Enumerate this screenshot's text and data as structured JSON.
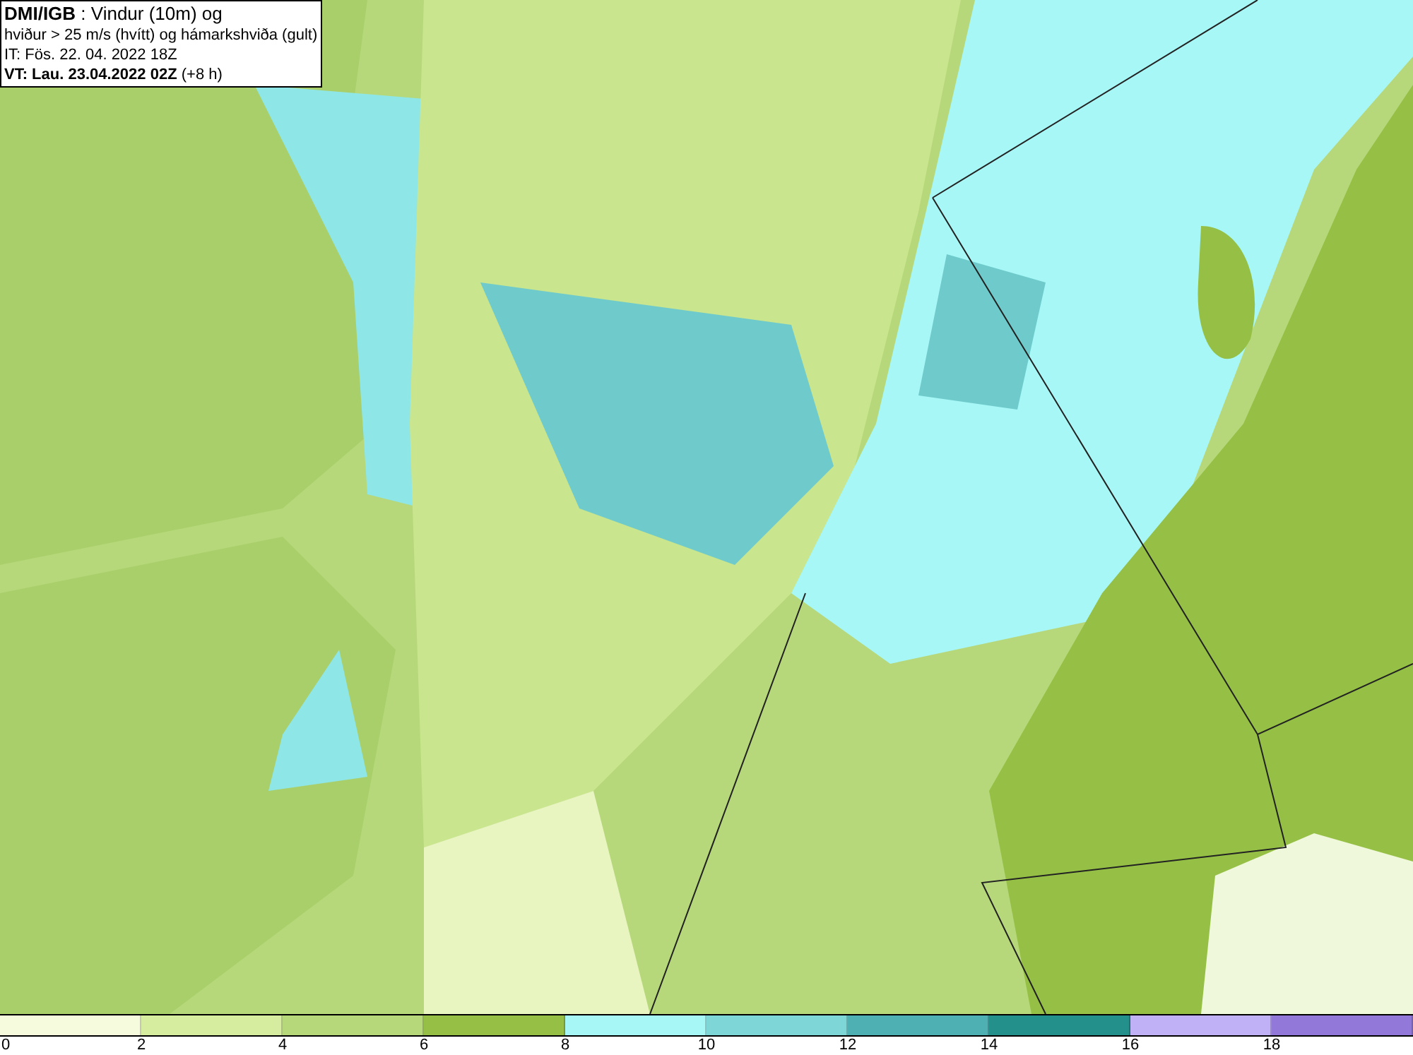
{
  "title_box": {
    "lines": [
      "**DMI/IGB** : Vindur (10m) og",
      "hviður > 25 m/s (hvítt) og hámarkshviða (gult)",
      "IT: Fös. 22. 04. 2022 18Z",
      "**VT: Lau. 23.04.2022 02Z** (+8 h)"
    ]
  },
  "legend": {
    "segments": [
      {
        "color": "#f5fbdc"
      },
      {
        "color": "#d6eda0"
      },
      {
        "color": "#b6d87a"
      },
      {
        "color": "#95c045"
      },
      {
        "color": "#a8f7f7"
      },
      {
        "color": "#7fd6d6"
      },
      {
        "color": "#4fb0b4"
      },
      {
        "color": "#23908c"
      },
      {
        "color": "#c0b0f5"
      },
      {
        "color": "#9278d8"
      }
    ],
    "tick_labels": [
      "0",
      "2",
      "4",
      "6",
      "8",
      "10",
      "12",
      "14",
      "16",
      "18"
    ]
  }
}
